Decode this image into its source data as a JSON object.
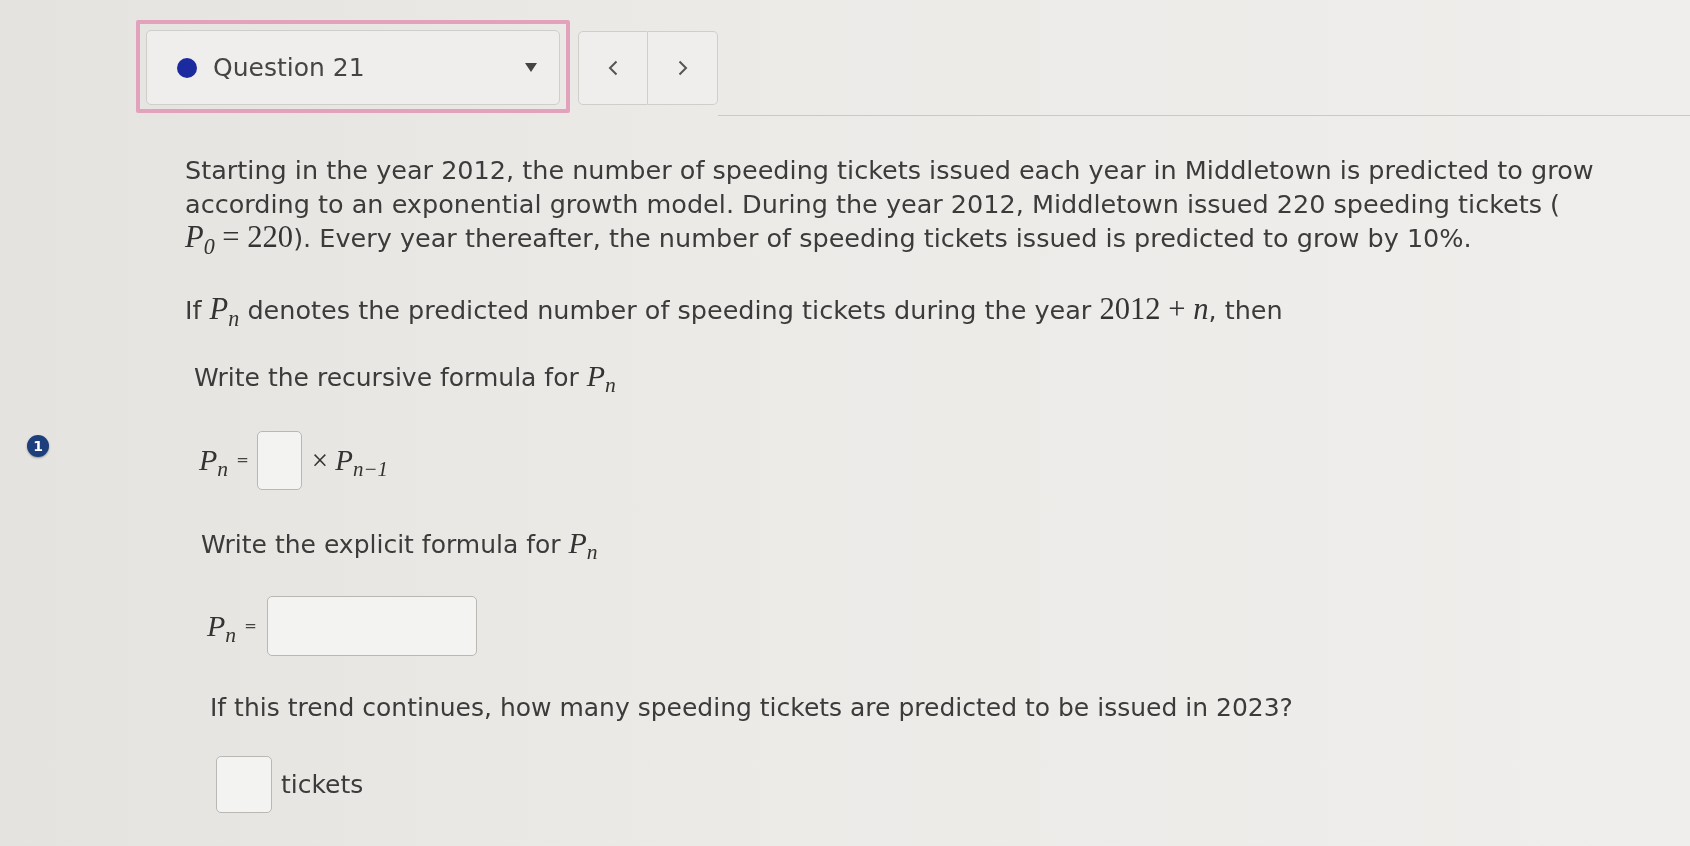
{
  "question_select": {
    "label": "Question 21",
    "focused": true
  },
  "nav_buttons": [
    {
      "kind": "previous"
    },
    {
      "kind": "next"
    }
  ],
  "intro": {
    "lines": [
      [
        {
          "kind": "text",
          "text": "Starting in the year 2012, the number of speeding tickets issued each year in Middletown is predicted to grow"
        }
      ],
      [
        {
          "kind": "text",
          "text": "according to an exponential growth model. During the year 2012, Middletown issued 220 speeding tickets ("
        }
      ],
      [
        {
          "kind": "math",
          "text": "*P*$_{0}$ = 220"
        },
        {
          "kind": "text",
          "text": "). Every year thereafter, the number of speeding tickets issued is predicted to grow by 10%."
        }
      ]
    ]
  },
  "definition": [
    {
      "kind": "text",
      "text": "If "
    },
    {
      "kind": "math",
      "text": "*P*$_{n}$"
    },
    {
      "kind": "text",
      "text": " denotes the predicted number of speeding tickets during the year "
    },
    {
      "kind": "math",
      "text": "2012 + *n*"
    },
    {
      "kind": "text",
      "text": ", then"
    }
  ],
  "part_number": "1",
  "recursive": {
    "prompt": [
      {
        "kind": "text",
        "text": "Write the recursive formula for "
      },
      {
        "kind": "math",
        "text": "*P*$_{n}$"
      }
    ],
    "lhs": "*P*$_{n}$",
    "equals": "=",
    "rhs": "× *P*$_{n−1}$"
  },
  "explicit": {
    "prompt": [
      {
        "kind": "text",
        "text": "Write the explicit formula for "
      },
      {
        "kind": "math",
        "text": "*P*$_{n}$"
      }
    ],
    "lhs": "*P*$_{n}$",
    "equals": "="
  },
  "forecast": {
    "question": "If this trend continues, how many speeding tickets are predicted to be issued in 2023?",
    "unit": "tickets"
  }
}
